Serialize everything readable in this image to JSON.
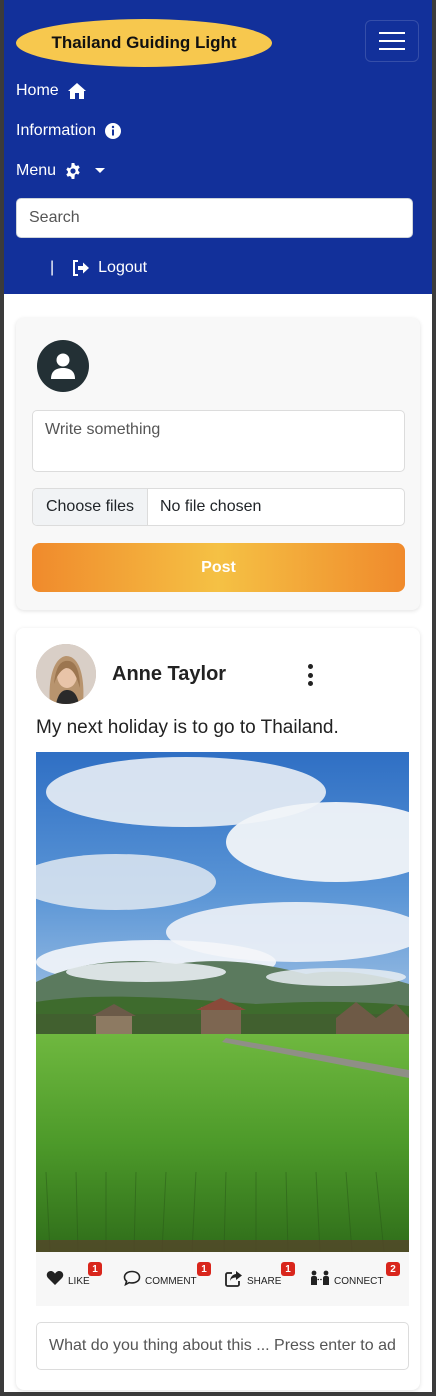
{
  "navbar": {
    "brand": "Thailand Guiding Light",
    "links": [
      {
        "label": "Home",
        "icon": "home-icon"
      },
      {
        "label": "Information",
        "icon": "info-circle-icon"
      },
      {
        "label": "Menu",
        "icon": "gear-icon"
      }
    ],
    "search_placeholder": "Search",
    "separator": "|",
    "logout": "Logout"
  },
  "composer": {
    "write_placeholder": "Write something",
    "choose_files": "Choose files",
    "no_file": "No file chosen",
    "post_button": "Post"
  },
  "post": {
    "author": "Anne Taylor",
    "text": "My next holiday is to go to Thailand.",
    "actions": [
      {
        "label": "Like",
        "count": "1",
        "icon": "heart-icon"
      },
      {
        "label": "Comment",
        "count": "1",
        "icon": "speech-bubble-icon"
      },
      {
        "label": "Share",
        "count": "1",
        "icon": "share-icon"
      },
      {
        "label": "Connect",
        "count": "2",
        "icon": "connect-people-icon"
      }
    ],
    "comment_placeholder": "What do you thing about this ... Press enter to add"
  },
  "colors": {
    "navbar": "#12309a",
    "brand_pill": "#f7c84e",
    "post_button_orange": "#f08a2c",
    "post_button_yellow": "#f5c144",
    "badge": "#d9261c"
  }
}
